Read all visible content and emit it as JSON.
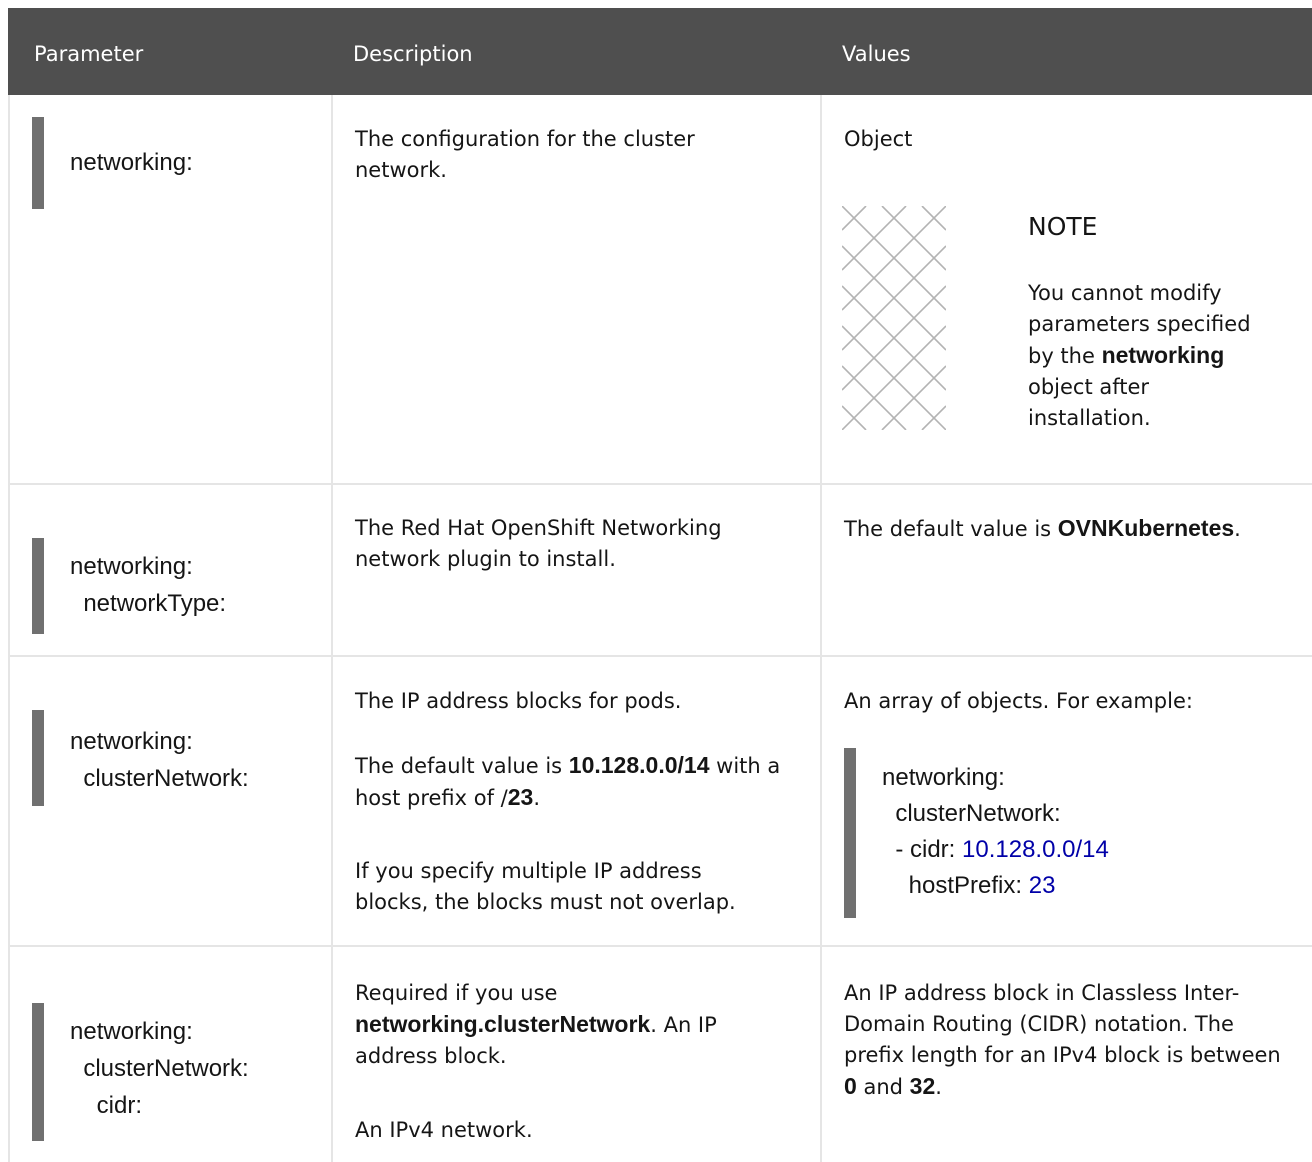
{
  "header": {
    "col1": "Parameter",
    "col2": "Description",
    "col3": "Values"
  },
  "rows": [
    {
      "param": [
        "networking:"
      ],
      "description": "The configuration for the cluster network.",
      "value": "Object",
      "note": {
        "title": "NOTE",
        "text_before": "You cannot modify parameters specified by the ",
        "bold": "networking",
        "text_after": " object after installation."
      }
    },
    {
      "param": [
        "networking:",
        "  networkType:"
      ],
      "description": "The Red Hat OpenShift Networking network plugin to install.",
      "value_before": "The default value is ",
      "value_bold": "OVNKubernetes",
      "value_after": "."
    },
    {
      "param": [
        "networking:",
        "  clusterNetwork:"
      ],
      "description_1": "The IP address blocks for pods.",
      "description_2_before": "The default value is ",
      "description_2_bold": "10.128.0.0/14",
      "description_2_mid": " with a host prefix of /",
      "description_2_bold2": "23",
      "description_2_after": ".",
      "description_3": "If you specify multiple IP address blocks, the blocks must not overlap.",
      "value": "An array of objects. For example:",
      "example": {
        "line1": "networking:",
        "line2": "  clusterNetwork:",
        "line3_key": "  - cidr: ",
        "line3_val": "10.128.0.0/14",
        "line4_key": "    hostPrefix: ",
        "line4_val": "23"
      }
    },
    {
      "param": [
        "networking:",
        "  clusterNetwork:",
        "    cidr:"
      ],
      "description_1_before": "Required if you use ",
      "description_1_bold": "networking.clusterNetwork",
      "description_1_after": ". An IP address block.",
      "description_2": "An IPv4 network.",
      "value_before": "An IP address block in Classless Inter-Domain Routing (CIDR) notation. The prefix length for an IPv4 block is between ",
      "value_bold1": "0",
      "value_mid": " and ",
      "value_bold2": "32",
      "value_after": "."
    }
  ]
}
